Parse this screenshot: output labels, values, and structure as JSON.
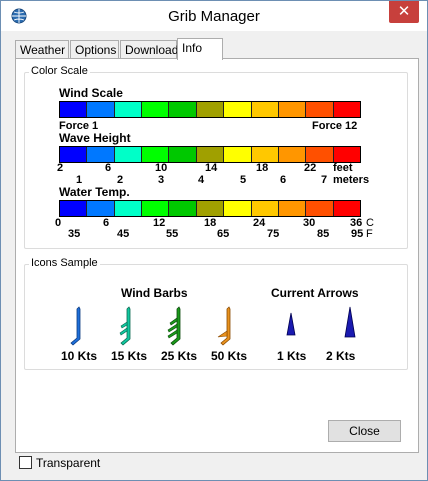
{
  "window": {
    "title": "Grib Manager",
    "close_glyph": "✕"
  },
  "tabs": [
    {
      "label": "Weather",
      "active": false
    },
    {
      "label": "Options",
      "active": false
    },
    {
      "label": "Download",
      "active": false
    },
    {
      "label": "Info",
      "active": true
    }
  ],
  "color_scale": {
    "group_label": "Color Scale",
    "colors": [
      "#0000ff",
      "#0078ff",
      "#00ffc8",
      "#00ff00",
      "#00c800",
      "#a0a000",
      "#ffff00",
      "#ffc800",
      "#ff9600",
      "#ff5000",
      "#ff0000"
    ],
    "wind": {
      "title": "Wind Scale",
      "min_label": "Force 1",
      "max_label": "Force 12"
    },
    "wave": {
      "title": "Wave Height",
      "feet": [
        "2",
        "6",
        "10",
        "14",
        "18",
        "22"
      ],
      "feet_unit": "feet",
      "meters": [
        "1",
        "2",
        "3",
        "4",
        "5",
        "6",
        "7"
      ],
      "meters_unit": "meters"
    },
    "water": {
      "title": "Water Temp.",
      "celsius": [
        "0",
        "6",
        "12",
        "18",
        "24",
        "30",
        "36"
      ],
      "celsius_unit": "C",
      "fahrenheit": [
        "35",
        "45",
        "55",
        "65",
        "75",
        "85",
        "95"
      ],
      "fahrenheit_unit": "F"
    }
  },
  "icons_sample": {
    "group_label": "Icons Sample",
    "wind_barbs_heading": "Wind Barbs",
    "current_arrows_heading": "Current Arrows",
    "wind_barbs": [
      {
        "label": "10 Kts",
        "icon": "wind-barb-10-icon",
        "color": "#1e6fd9"
      },
      {
        "label": "15 Kts",
        "icon": "wind-barb-15-icon",
        "color": "#10c8a0"
      },
      {
        "label": "25 Kts",
        "icon": "wind-barb-25-icon",
        "color": "#1a9a1a"
      },
      {
        "label": "50 Kts",
        "icon": "wind-barb-50-icon",
        "color": "#e8921e"
      }
    ],
    "current_arrows": [
      {
        "label": "1 Kts",
        "icon": "current-arrow-1-icon",
        "color": "#1a1ab0"
      },
      {
        "label": "2 Kts",
        "icon": "current-arrow-2-icon",
        "color": "#1a1ab0"
      }
    ]
  },
  "close_button": "Close",
  "transparent_checkbox": {
    "label": "Transparent",
    "checked": false
  }
}
